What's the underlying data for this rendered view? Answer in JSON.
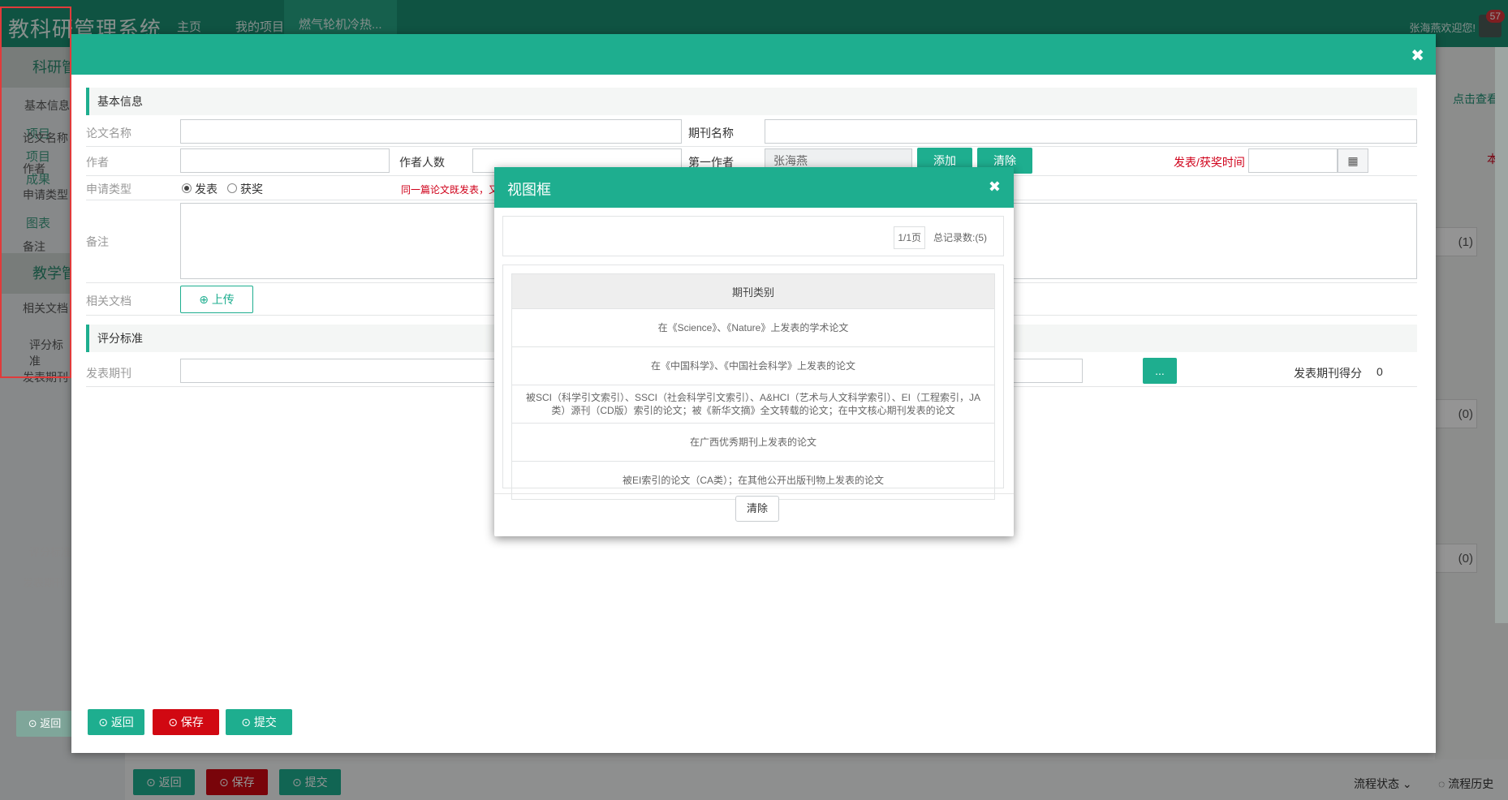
{
  "app": {
    "brand": "教科研管理系统",
    "nav": [
      "主页",
      "我的项目",
      "燃气轮机冷热..."
    ],
    "user": "张海燕欢迎您!",
    "badge": "57",
    "sidebar": {
      "group1": "科研管",
      "items1": [
        "项目",
        "项目",
        "成果",
        "图表"
      ],
      "group2": "教学管"
    },
    "right": {
      "link": "点击查看",
      "mark": "本",
      "counts": [
        "(1)",
        "(0)",
        "(0)"
      ]
    },
    "footer": {
      "buttons": [
        "返回",
        "保存",
        "提交"
      ],
      "flow_status": "流程状态",
      "flow_history": "流程历史"
    }
  },
  "modal": {
    "close_icon": "close-icon",
    "section_basic": "基本信息",
    "fields": {
      "paper_name": "论文名称",
      "journal_name": "期刊名称",
      "author": "作者",
      "author_count": "作者人数",
      "first_author": "第一作者",
      "first_author_value": "张海燕",
      "add": "添加",
      "clear": "清除",
      "pub_time": "发表/获奖时间",
      "apply_type": "申请类型",
      "radio_publish": "发表",
      "radio_award": "获奖",
      "warning": "同一篇论文既发表，又获",
      "remark": "备注",
      "docs": "相关文档",
      "upload": "上传"
    },
    "section_score": "评分标准",
    "score": {
      "journal": "发表期刊",
      "more": "...",
      "journal_score_label": "发表期刊得分",
      "journal_score_value": "0"
    },
    "buttons": {
      "back": "返回",
      "save": "保存",
      "submit": "提交"
    },
    "ghost_left": {
      "items": [
        "基本信息",
        "论文名称",
        "作者",
        "申请类型",
        "备注",
        "相关文档",
        "评分标准",
        "发表期刊",
        "评分标准",
        "发表期刊"
      ],
      "back": "返回"
    }
  },
  "dialog": {
    "title": "视图框",
    "pager_page": "1/1页",
    "pager_total": "总记录数:(5)",
    "column": "期刊类别",
    "rows": [
      "在《Science》、《Nature》上发表的学术论文",
      "在《中国科学》、《中国社会科学》上发表的论文",
      "被SCI（科学引文索引）、SSCI（社会科学引文索引）、A&HCI（艺术与人文科学索引）、EI（工程索引，JA类）源刊（CD版）索引的论文；被《新华文摘》全文转载的论文；在中文核心期刊发表的论文",
      "在广西优秀期刊上发表的论文",
      "被EI索引的论文（CA类）；在其他公开出版刊物上发表的论文"
    ],
    "clear": "清除"
  }
}
